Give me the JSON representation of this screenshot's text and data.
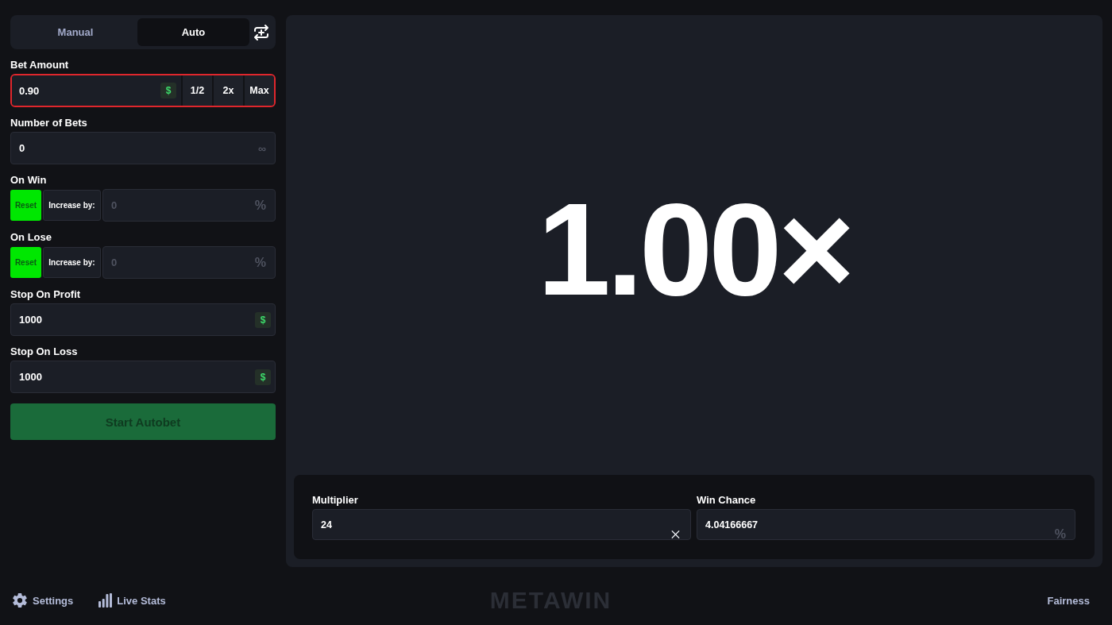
{
  "mode_tabs": [
    {
      "label": "Manual",
      "selected": false
    },
    {
      "label": "Auto",
      "selected": true
    }
  ],
  "bet_amount": {
    "label": "Bet Amount",
    "value": "0.90",
    "currency": "$",
    "invalid": true,
    "buttons": [
      "1/2",
      "2x",
      "Max"
    ]
  },
  "number_of_bets": {
    "label": "Number of Bets",
    "value": "0",
    "suffix": "∞"
  },
  "on_win": {
    "label": "On Win",
    "options": [
      {
        "label": "Reset",
        "selected": true
      },
      {
        "label": "Increase by:",
        "selected": false
      }
    ],
    "value": "0",
    "unit": "%"
  },
  "on_lose": {
    "label": "On Lose",
    "options": [
      {
        "label": "Reset",
        "selected": true
      },
      {
        "label": "Increase by:",
        "selected": false
      }
    ],
    "value": "0",
    "unit": "%"
  },
  "stop_on_profit": {
    "label": "Stop On Profit",
    "value": "1000",
    "currency": "$"
  },
  "stop_on_loss": {
    "label": "Stop On Loss",
    "value": "1000",
    "currency": "$"
  },
  "start_button": {
    "label": "Start Autobet",
    "disabled": true
  },
  "result": "1.00×",
  "multiplier": {
    "label": "Multiplier",
    "value": "24"
  },
  "win_chance": {
    "label": "Win Chance",
    "value": "4.04166667",
    "unit": "%"
  },
  "footer": {
    "links": [
      {
        "kind": "settings",
        "label": "Settings"
      },
      {
        "kind": "stats",
        "label": "Live Stats"
      }
    ],
    "logo": "METAWIN",
    "fairness": "Fairness"
  }
}
